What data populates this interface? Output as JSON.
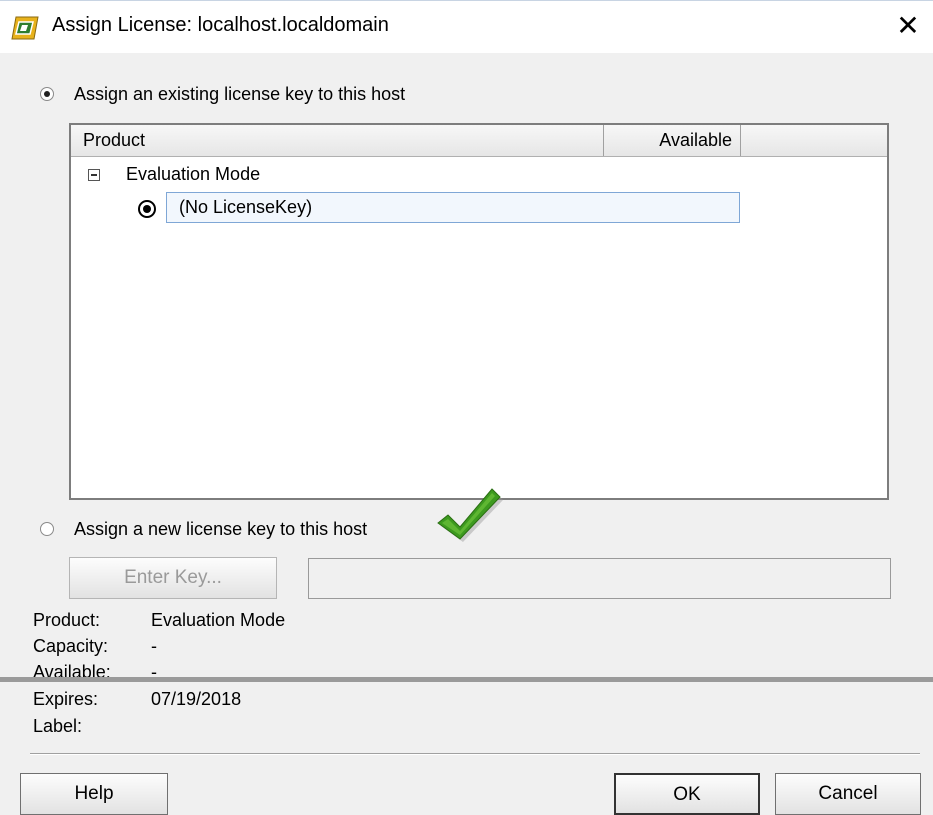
{
  "window": {
    "title": "Assign License: localhost.localdomain",
    "close_glyph": "✕"
  },
  "option_existing": {
    "label": "Assign an existing license key to this host",
    "selected": true
  },
  "license_table": {
    "columns": [
      "Product",
      "Available"
    ],
    "group": {
      "label": "Evaluation Mode",
      "expanded": true
    },
    "items": [
      {
        "label": "(No LicenseKey)",
        "selected": true
      }
    ]
  },
  "option_new": {
    "label": "Assign a new license key to this host",
    "selected": false
  },
  "enter_key_button": "Enter Key...",
  "key_field": {
    "value": ""
  },
  "info": {
    "product_label": "Product:",
    "product_value": "Evaluation Mode",
    "capacity_label": "Capacity:",
    "capacity_value": "-",
    "available_label": "Available:",
    "available_value": "-",
    "expires_label": "Expires:",
    "expires_value": "07/19/2018",
    "label_label": "Label:",
    "label_value": ""
  },
  "buttons": {
    "help": "Help",
    "ok": "OK",
    "cancel": "Cancel"
  },
  "icons": {
    "app": "vsphere-app-icon",
    "check": "green-checkmark-icon"
  },
  "colors": {
    "checkmark": "#3d9a1f",
    "app_icon": "#e8b21c",
    "selection_border": "#7fa7d6"
  }
}
